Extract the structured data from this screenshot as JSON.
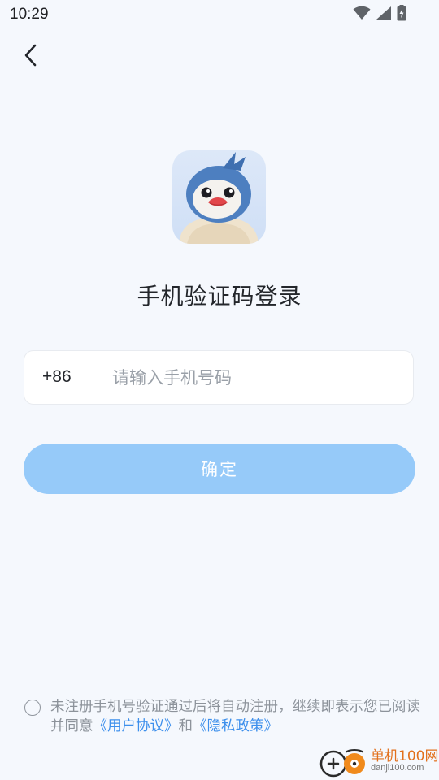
{
  "status_bar": {
    "time": "10:29"
  },
  "header": {
    "back_icon": "chevron-left-icon"
  },
  "login": {
    "title": "手机验证码登录",
    "country_code": "+86",
    "phone_placeholder": "请输入手机号码",
    "phone_value": "",
    "confirm_label": "确定"
  },
  "agreement": {
    "checked": false,
    "text_prefix": "未注册手机号验证通过后将自动注册，继续即表示您已阅读并同意",
    "user_agreement_link": "《用户协议》",
    "conjunction": "和",
    "privacy_policy_link": "《隐私政策》"
  },
  "watermark": {
    "name": "单机100网",
    "url": "danji100.com"
  },
  "colors": {
    "background": "#f5f8fd",
    "button": "#96caf9",
    "link": "#3d8fec",
    "watermark": "#e2701c"
  }
}
